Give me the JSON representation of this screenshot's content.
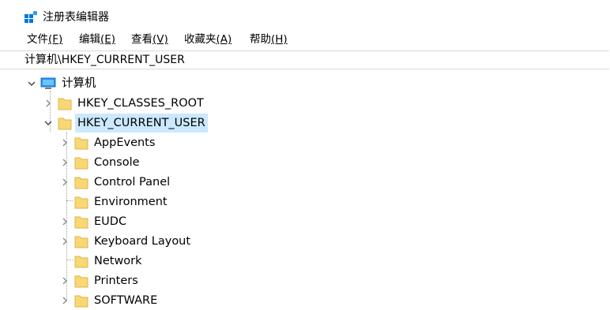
{
  "window": {
    "title": "注册表编辑器",
    "icon": "registry-editor-icon"
  },
  "menu": [
    {
      "name": "menu-file",
      "label": "文件",
      "mnemonic": "(F)"
    },
    {
      "name": "menu-edit",
      "label": "编辑",
      "mnemonic": "(E)"
    },
    {
      "name": "menu-view",
      "label": "查看",
      "mnemonic": "(V)"
    },
    {
      "name": "menu-favorites",
      "label": "收藏夹",
      "mnemonic": "(A)"
    },
    {
      "name": "menu-help",
      "label": "帮助",
      "mnemonic": "(H)"
    }
  ],
  "address": "计算机\\HKEY_CURRENT_USER",
  "tree": {
    "root": {
      "label": "计算机",
      "icon": "computer-icon",
      "expanded": true
    },
    "hives": [
      {
        "label": "HKEY_CLASSES_ROOT",
        "expanded": false,
        "selected": false
      },
      {
        "label": "HKEY_CURRENT_USER",
        "expanded": true,
        "selected": true
      }
    ],
    "hkcu_children": [
      {
        "label": "AppEvents",
        "has_children": true
      },
      {
        "label": "Console",
        "has_children": true
      },
      {
        "label": "Control Panel",
        "has_children": true
      },
      {
        "label": "Environment",
        "has_children": false
      },
      {
        "label": "EUDC",
        "has_children": true
      },
      {
        "label": "Keyboard Layout",
        "has_children": true
      },
      {
        "label": "Network",
        "has_children": false
      },
      {
        "label": "Printers",
        "has_children": true
      },
      {
        "label": "SOFTWARE",
        "has_children": true
      }
    ]
  },
  "colors": {
    "selection": "#cce8ff",
    "folder_fill": "#f8d775",
    "folder_edge": "#e0b64a",
    "accent": "#0078d7"
  }
}
